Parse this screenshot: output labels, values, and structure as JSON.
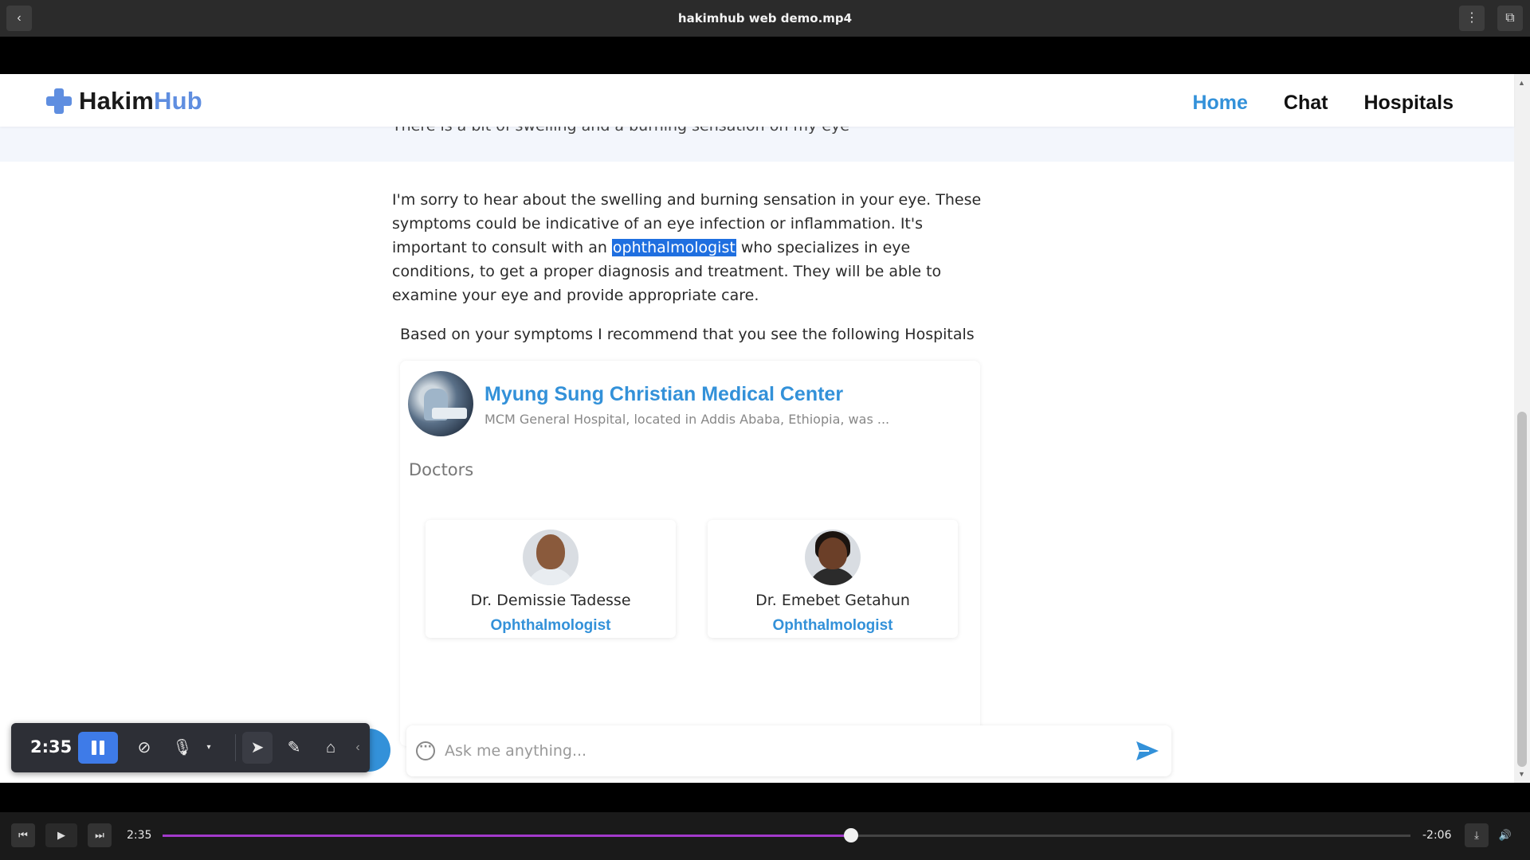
{
  "player": {
    "title": "hakimhub web demo.mp4",
    "current_time": "2:35",
    "remaining_time": "-2:06",
    "progress_fraction": 0.552
  },
  "site": {
    "logo_main": "Hakim",
    "logo_accent": "Hub",
    "nav": [
      {
        "label": "Home",
        "active": true
      },
      {
        "label": "Chat",
        "active": false
      },
      {
        "label": "Hospitals",
        "active": false
      }
    ],
    "brand_color": "#3391d9"
  },
  "chat": {
    "user_message_clipped": "There is a bit of swelling and a burning sensation on my eye",
    "answer_before": "I'm sorry to hear about the swelling and burning sensation in your eye. These symptoms could be indicative of an eye infection or inflammation. It's important to consult with an ",
    "answer_highlight": "ophthalmologist",
    "answer_after": " who specializes in eye conditions, to get a proper diagnosis and treatment. They will be able to examine your eye and provide appropriate care.",
    "recommendation": "Based on your symptoms I recommend that you see the following Hospitals",
    "hospital": {
      "name": "Myung Sung Christian Medical Center",
      "description": "MCM General Hospital, located in Addis Ababa, Ethiopia, was ...",
      "doctors_heading": "Doctors",
      "doctors": [
        {
          "name": "Dr. Demissie Tadesse",
          "specialty": "Ophthalmologist"
        },
        {
          "name": "Dr. Emebet Getahun",
          "specialty": "Ophthalmologist"
        }
      ]
    },
    "input_placeholder": "Ask me anything..."
  },
  "recorder": {
    "time": "2:35"
  },
  "icons": {
    "back": "chevron-left-icon",
    "more": "more-vertical-icon",
    "pip": "picture-in-picture-icon",
    "send": "send-icon",
    "chat": "chat-bubble-icon"
  }
}
